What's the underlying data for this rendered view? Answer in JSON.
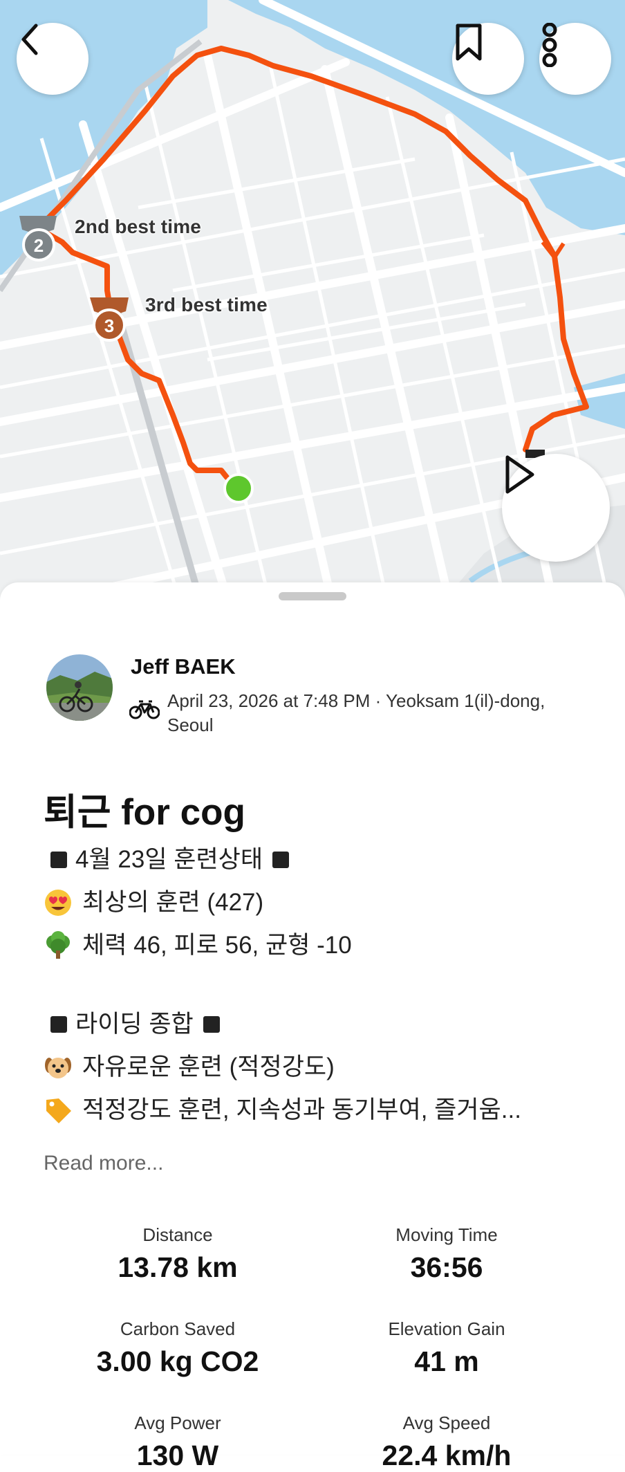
{
  "map": {
    "medals": [
      {
        "rank": "2",
        "label": "2nd best time"
      },
      {
        "rank": "3",
        "label": "3rd best time"
      }
    ],
    "route_color": "#f4510f",
    "start_marker_color": "#5ec72d"
  },
  "activity": {
    "athlete": "Jeff BAEK",
    "datetime_location": "April 23, 2026 at 7:48 PM · Yeoksam 1(il)-dong, Seoul",
    "title": "퇴근 for cog",
    "description": [
      "4월 23일 훈련상태",
      "최상의 훈련 (427)",
      "체력 46, 피로 56, 균형 -10",
      "라이딩 종합",
      "자유로운 훈련 (적정강도)",
      "적정강도 훈련, 지속성과 동기부여, 즐거움..."
    ],
    "read_more": "Read more..."
  },
  "stats": [
    {
      "label": "Distance",
      "value": "13.78 km"
    },
    {
      "label": "Moving Time",
      "value": "36:56"
    },
    {
      "label": "Carbon Saved",
      "value": "3.00 kg CO2"
    },
    {
      "label": "Elevation Gain",
      "value": "41 m"
    },
    {
      "label": "Avg Power",
      "value": "130 W"
    },
    {
      "label": "Avg Speed",
      "value": "22.4 km/h"
    }
  ]
}
